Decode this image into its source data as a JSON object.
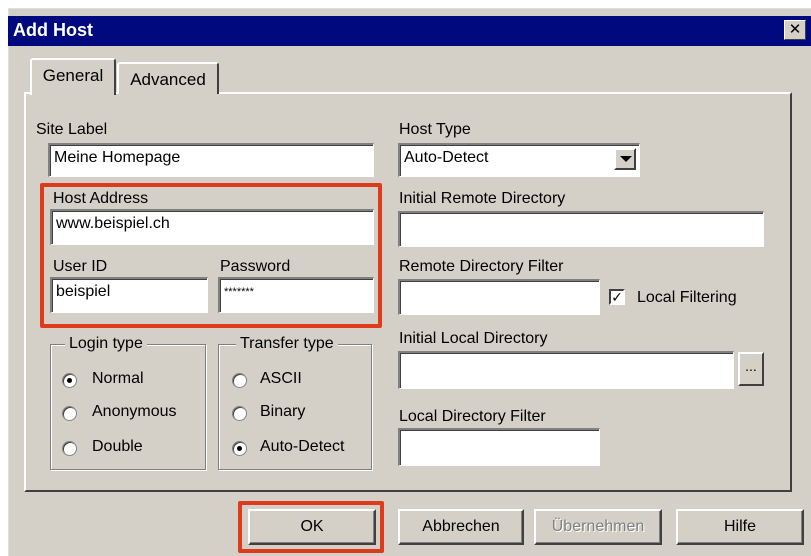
{
  "window": {
    "title": "Add Host",
    "close_glyph": "✕"
  },
  "tabs": [
    {
      "label": "General",
      "selected": true
    },
    {
      "label": "Advanced",
      "selected": false
    }
  ],
  "fields": {
    "site_label": {
      "label": "Site Label",
      "value": "Meine Homepage"
    },
    "host_address": {
      "label": "Host Address",
      "value": "www.beispiel.ch"
    },
    "user_id": {
      "label": "User ID",
      "value": "beispiel"
    },
    "password": {
      "label": "Password",
      "value": "*******"
    },
    "host_type": {
      "label": "Host Type",
      "value": "Auto-Detect"
    },
    "initial_remote_directory": {
      "label": "Initial Remote Directory",
      "value": ""
    },
    "remote_directory_filter": {
      "label": "Remote Directory Filter",
      "value": ""
    },
    "local_filtering": {
      "label": "Local Filtering",
      "checked": true,
      "glyph": "✓"
    },
    "initial_local_directory": {
      "label": "Initial Local Directory",
      "value": "",
      "browse_label": "..."
    },
    "local_directory_filter": {
      "label": "Local Directory Filter",
      "value": ""
    }
  },
  "login_type": {
    "title": "Login type",
    "options": [
      {
        "label": "Normal",
        "selected": true
      },
      {
        "label": "Anonymous",
        "selected": false
      },
      {
        "label": "Double",
        "selected": false
      }
    ]
  },
  "transfer_type": {
    "title": "Transfer type",
    "options": [
      {
        "label": "ASCII",
        "selected": false
      },
      {
        "label": "Binary",
        "selected": false
      },
      {
        "label": "Auto-Detect",
        "selected": true
      }
    ]
  },
  "buttons": {
    "ok": "OK",
    "cancel": "Abbrechen",
    "apply": "Übernehmen",
    "help": "Hilfe"
  },
  "highlight_color": "#de3b1c",
  "title_bar_color": "#000a7e"
}
